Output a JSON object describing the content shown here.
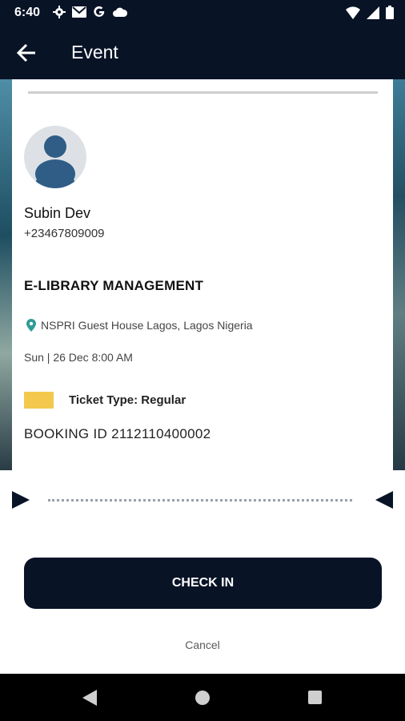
{
  "status_bar": {
    "time": "6:40",
    "left_icons": [
      "gear-icon",
      "gmail-icon",
      "google-icon",
      "cloud-icon"
    ],
    "right_icons": [
      "wifi-icon",
      "signal-icon",
      "battery-icon"
    ]
  },
  "app_bar": {
    "title": "Event",
    "back_icon": "arrow-left-icon"
  },
  "attendee": {
    "name": "Subin Dev",
    "phone": "+23467809009"
  },
  "event": {
    "title": "E-LIBRARY MANAGEMENT",
    "location": "NSPRI Guest House Lagos, Lagos Nigeria",
    "datetime": "Sun | 26 Dec 8:00 AM",
    "ticket_type": "Ticket Type: Regular",
    "ticket_color": "#f2c94c",
    "booking_id": "BOOKING ID 2112110400002"
  },
  "actions": {
    "checkin_label": "CHECK IN",
    "cancel_label": "Cancel"
  },
  "colors": {
    "primary": "#081326",
    "location_pin": "#2e9c96"
  }
}
